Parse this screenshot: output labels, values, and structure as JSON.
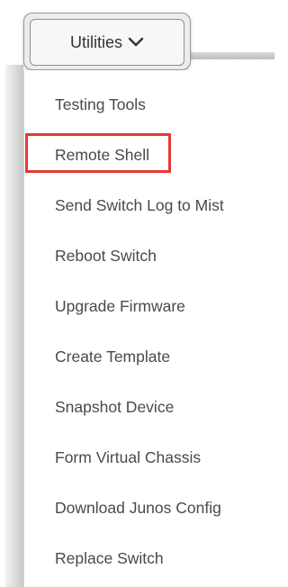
{
  "utilities_button": {
    "label": "Utilities",
    "icon": "chevron-down-icon"
  },
  "menu": {
    "items": [
      {
        "label": "Testing Tools"
      },
      {
        "label": "Remote Shell",
        "highlighted": true
      },
      {
        "label": "Send Switch Log to Mist"
      },
      {
        "label": "Reboot Switch"
      },
      {
        "label": "Upgrade Firmware"
      },
      {
        "label": "Create Template"
      },
      {
        "label": "Snapshot Device"
      },
      {
        "label": "Form Virtual Chassis"
      },
      {
        "label": "Download Junos Config"
      },
      {
        "label": "Replace Switch"
      }
    ]
  },
  "colors": {
    "highlight": "#e53935",
    "text": "#4a4a4a"
  }
}
